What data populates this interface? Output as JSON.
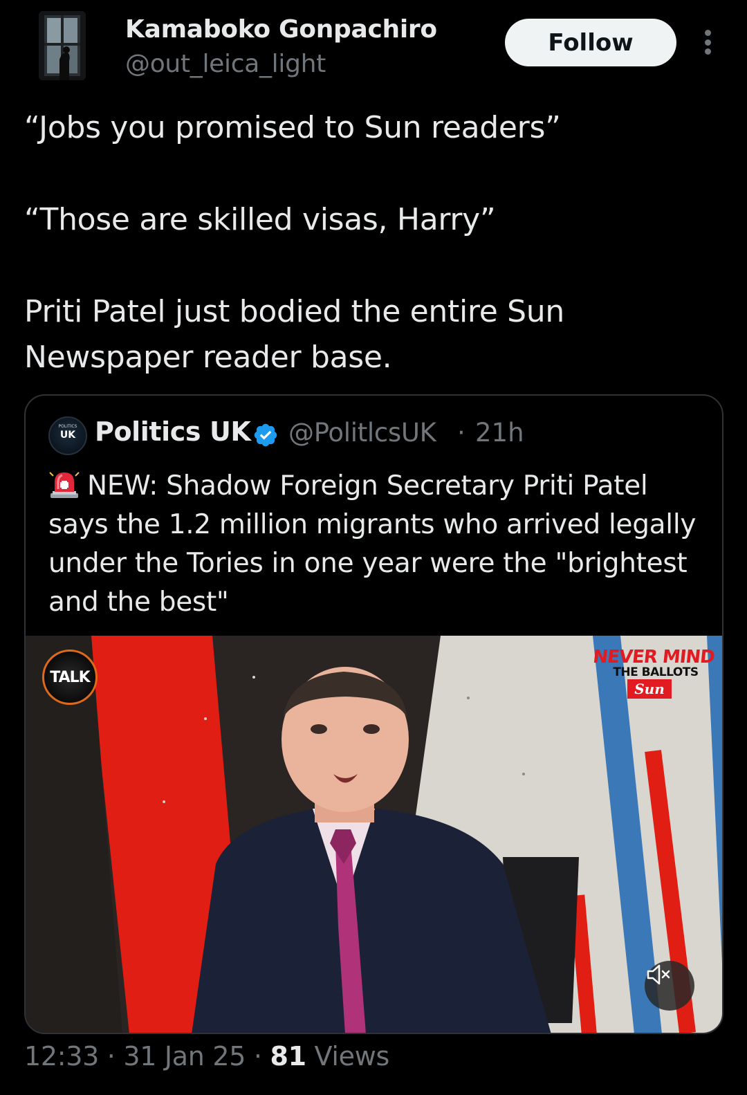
{
  "author": {
    "name": "Kamaboko Gonpachiro",
    "handle": "@out_leica_light",
    "follow_label": "Follow"
  },
  "tweet": {
    "line1": "“Jobs you promised to Sun readers”",
    "line2": "“Those are skilled visas, Harry”",
    "line3a": "Priti Patel just bodied the entire Sun",
    "line3b": "Newspaper reader base."
  },
  "quoted": {
    "avatar_small": "POLITICS",
    "avatar_text": "UK",
    "name": "Politics UK",
    "handle": "@PolitlcsUK",
    "separator": "·",
    "time": "21h",
    "text": "NEW: Shadow Foreign Secretary Priti Patel says the 1.2 million migrants who arrived legally under the Tories in one year were the \"brightest and the best\"",
    "media": {
      "channel_logo": "TALK",
      "banner_top": "NEVER MIND",
      "banner_mid": "THE BALLOTS",
      "banner_brand": "Sun"
    }
  },
  "footer": {
    "time": "12:33",
    "sep1": "·",
    "date": "31 Jan 25",
    "sep2": "·",
    "views_count": "81",
    "views_label": "Views"
  },
  "colors": {
    "background": "#000000",
    "text_primary": "#e7e9ea",
    "text_secondary": "#71767b",
    "border": "#2f3336",
    "verified": "#1d9bf0",
    "follow_bg": "#eff3f4"
  },
  "icons": [
    "more-icon",
    "verified-badge-icon",
    "siren-icon",
    "mute-icon"
  ]
}
